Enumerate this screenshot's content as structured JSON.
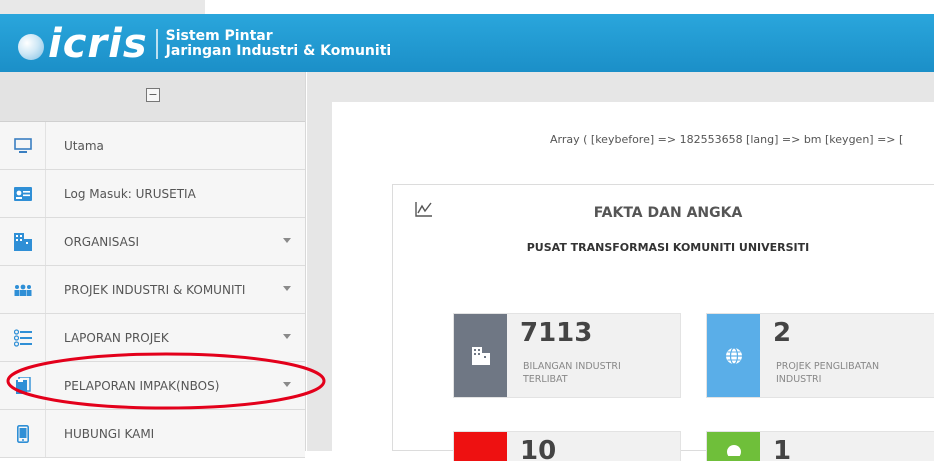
{
  "header": {
    "brand": "icris",
    "tagline_line1": "Sistem Pintar",
    "tagline_line2": "Jaringan Industri & Komuniti",
    "color": "#1f9ad3"
  },
  "sidebar": {
    "collapse_symbol": "−",
    "items": [
      {
        "label": "Utama",
        "icon": "monitor-icon",
        "has_caret": false
      },
      {
        "label": "Log Masuk: URUSETIA",
        "icon": "id-card-icon",
        "has_caret": false
      },
      {
        "label": "ORGANISASI",
        "icon": "building-icon",
        "has_caret": true
      },
      {
        "label": "PROJEK INDUSTRI & KOMUNITI",
        "icon": "group-icon",
        "has_caret": true
      },
      {
        "label": "LAPORAN PROJEK",
        "icon": "list-icon",
        "has_caret": true
      },
      {
        "label": "PELAPORAN IMPAK(NBOS)",
        "icon": "clipboard-icon",
        "has_caret": true
      },
      {
        "label": "HUBUNGI KAMI",
        "icon": "phone-icon",
        "has_caret": false
      }
    ]
  },
  "main": {
    "array_text": "Array ( [keybefore] => 182553658 [lang] => bm [keygen] => [",
    "card": {
      "title": "FAKTA DAN ANGKA",
      "subtitle": "PUSAT TRANSFORMASI KOMUNITI UNIVERSITI",
      "stats": [
        {
          "value": "7113",
          "line1": "BILANGAN INDUSTRI",
          "line2": "TERLIBAT",
          "color": "#6f7784",
          "icon": "building-icon"
        },
        {
          "value": "2",
          "line1": "PROJEK PENGLIBATAN",
          "line2": "INDUSTRI",
          "color": "#5aaee8",
          "icon": "globe-icon"
        },
        {
          "value": "10",
          "line1": "",
          "line2": "",
          "color": "#ee1111",
          "icon": ""
        },
        {
          "value": "1",
          "line1": "",
          "line2": "",
          "color": "#6fbf3a",
          "icon": ""
        }
      ]
    }
  },
  "annotation": {
    "color": "#e3001b"
  }
}
